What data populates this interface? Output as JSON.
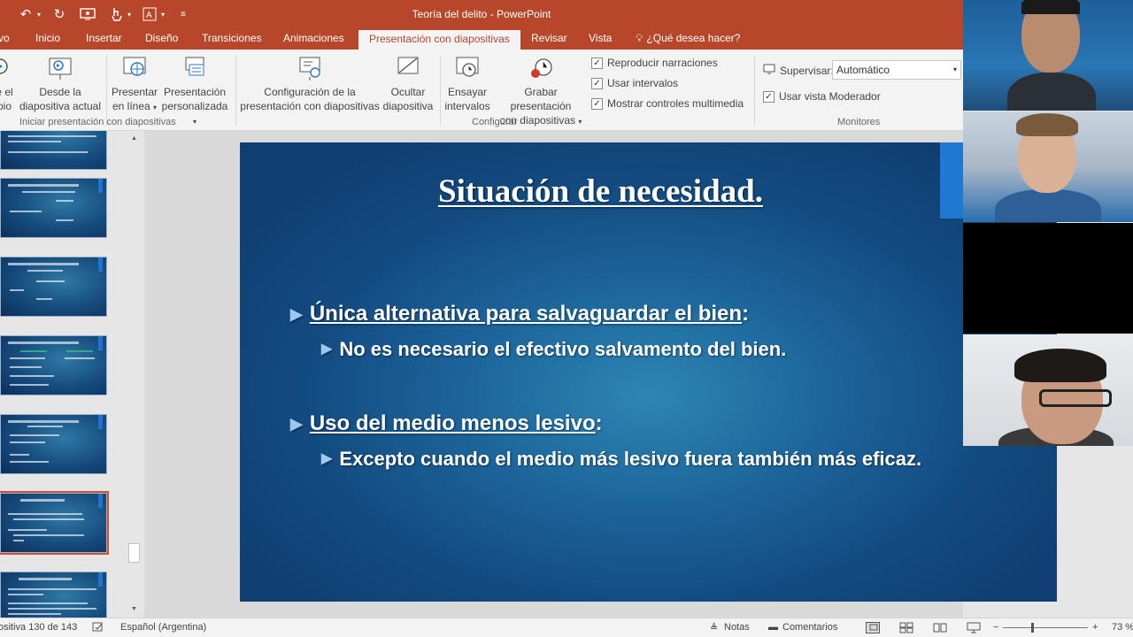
{
  "window": {
    "title": "Teoría del delito - PowerPoint"
  },
  "tabs": [
    {
      "label": "vo"
    },
    {
      "label": "Inicio"
    },
    {
      "label": "Insertar"
    },
    {
      "label": "Diseño"
    },
    {
      "label": "Transiciones"
    },
    {
      "label": "Animaciones"
    },
    {
      "label": "Presentación con diapositivas"
    },
    {
      "label": "Revisar"
    },
    {
      "label": "Vista"
    }
  ],
  "tell_me": "¿Qué desea hacer?",
  "ribbon": {
    "from_start": {
      "line1": "e el",
      "line2": "pio"
    },
    "from_current": {
      "line1": "Desde la",
      "line2": "diapositiva actual"
    },
    "present_online": {
      "line1": "Presentar",
      "line2": "en línea"
    },
    "custom_show": {
      "line1": "Presentación",
      "line2": "personalizada"
    },
    "group_start": "Iniciar presentación con diapositivas",
    "setup_show": {
      "line1": "Configuración de la",
      "line2": "presentación con diapositivas"
    },
    "hide_slide": {
      "line1": "Ocultar",
      "line2": "diapositiva"
    },
    "rehearse": {
      "line1": "Ensayar",
      "line2": "intervalos"
    },
    "record": {
      "line1": "Grabar presentación",
      "line2": "con diapositivas"
    },
    "play_narrations": "Reproducir narraciones",
    "use_timings": "Usar intervalos",
    "show_media_controls": "Mostrar controles multimedia",
    "group_setup": "Configurar",
    "monitor_label": "Supervisar:",
    "monitor_value": "Automático",
    "presenter_view": "Usar vista Moderador",
    "group_monitors": "Monitores"
  },
  "slide": {
    "title": "Situación de necesidad.",
    "bullets": [
      {
        "text": "Única alternativa para salvaguardar el bien",
        "suffix": ":"
      },
      {
        "text": "No es necesario el efectivo salvamento del bien."
      },
      {
        "text": "Uso del medio menos lesivo",
        "suffix": ":"
      },
      {
        "text": "Excepto cuando el medio más lesivo fuera también más eficaz."
      }
    ]
  },
  "status": {
    "slide_info": "ositiva 130 de 143",
    "language": "Español (Argentina)",
    "notes": "Notas",
    "comments": "Comentarios",
    "zoom": "73 %"
  }
}
